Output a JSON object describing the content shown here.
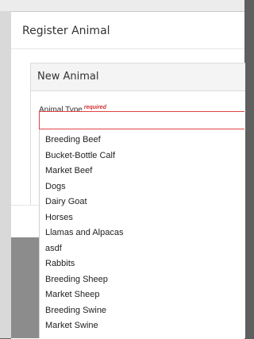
{
  "modal": {
    "title": "Register Animal"
  },
  "panel": {
    "title": "New Animal",
    "field_label": "Animal Type",
    "required_label": "required"
  },
  "select": {
    "value": "",
    "options": [
      "Breeding Beef",
      "Bucket-Bottle Calf",
      "Market Beef",
      "Dogs",
      "Dairy Goat",
      "Horses",
      "Llamas and Alpacas",
      "asdf",
      "Rabbits",
      "Breeding Sheep",
      "Market Sheep",
      "Breeding Swine",
      "Market Swine"
    ]
  },
  "colors": {
    "required": "#d32f2f",
    "error_border": "#e04444",
    "overlay": "#5f5f5f"
  }
}
